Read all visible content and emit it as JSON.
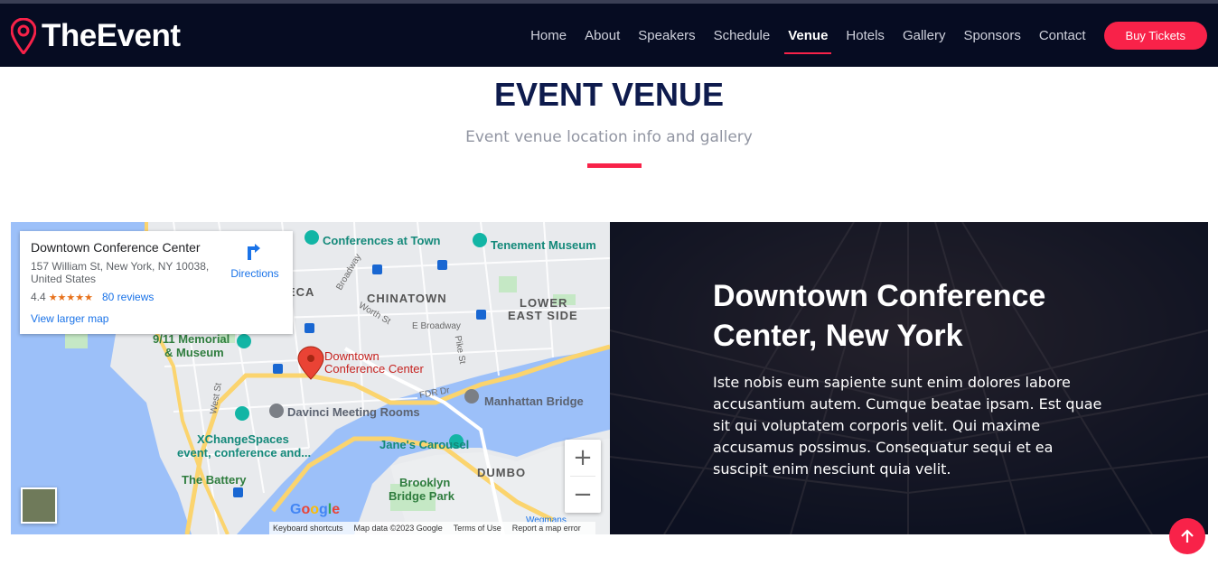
{
  "brand": {
    "logo_main": "The",
    "logo_accent": "Event"
  },
  "nav": {
    "items": [
      "Home",
      "About",
      "Speakers",
      "Schedule",
      "Venue",
      "Hotels",
      "Gallery",
      "Sponsors",
      "Contact"
    ],
    "active": "Venue",
    "cta": "Buy Tickets"
  },
  "section": {
    "title": "EVENT VENUE",
    "subtitle": "Event venue location info and gallery"
  },
  "map": {
    "card": {
      "name": "Downtown Conference Center",
      "address": "157 William St, New York, NY 10038, United States",
      "rating": "4.4",
      "stars": "★★★★★",
      "reviews": "80 reviews",
      "directions": "Directions",
      "view_larger": "View larger map"
    },
    "labels": {
      "conferences": "Conferences at Town",
      "tenement": "Tenement Museum",
      "chinatown": "CHINATOWN",
      "lower_east_1": "LOWER",
      "lower_east_2": "EAST SIDE",
      "memorial_1": "9/11 Memorial",
      "memorial_2": "& Museum",
      "marker_1": "Downtown",
      "marker_2": "Conference Center",
      "davinci": "Davinci Meeting Rooms",
      "manhattan_bridge": "Manhattan Bridge",
      "xchange_1": "XChangeSpaces",
      "xchange_2": "event, conference and...",
      "janes": "Jane's Carousel",
      "battery": "The Battery",
      "dumbo": "DUMBO",
      "brooklyn_1": "Brooklyn",
      "brooklyn_2": "Bridge Park",
      "broadway": "Broadway",
      "worth": "Worth St",
      "e_broadway": "E Broadway",
      "pike": "Pike St",
      "fdr": "FDR Dr",
      "west": "West St",
      "eca": "ECA",
      "wegmans": "Wegmans"
    },
    "google": "Google",
    "footer": [
      "Keyboard shortcuts",
      "Map data ©2023 Google",
      "Terms of Use",
      "Report a map error"
    ],
    "zoom_in": "+",
    "zoom_out": "−"
  },
  "venue": {
    "title": "Downtown Conference Center, New York",
    "description": "Iste nobis eum sapiente sunt enim dolores labore accusantium autem. Cumque beatae ipsam. Est quae sit qui voluptatem corporis velit. Qui maxime accusamus possimus. Consequatur sequi et ea suscipit enim nesciunt quia velit."
  },
  "colors": {
    "accent": "#f82249",
    "navy": "#060c22",
    "title": "#0e1b4d"
  }
}
